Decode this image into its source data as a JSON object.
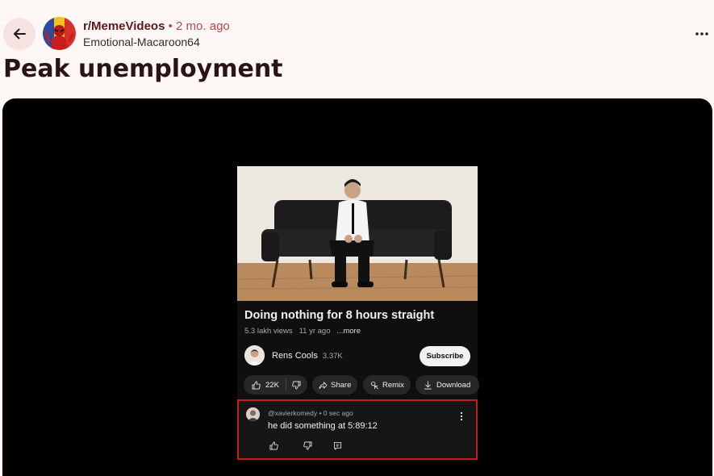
{
  "header": {
    "subreddit": "r/MemeVideos",
    "separator": "•",
    "age": "2 mo. ago",
    "author": "Emotional-Macaroon64",
    "more_icon": "more-horizontal-icon",
    "back_icon": "arrow-left-icon"
  },
  "post": {
    "title": "Peak unemployment"
  },
  "video": {
    "title": "Doing nothing for 8 hours straight",
    "views": "5.3 lakh views",
    "age": "11 yr ago",
    "more": "...more",
    "channel": {
      "name": "Rens Cools",
      "subscribers": "3.37K",
      "subscribe_label": "Subscribe"
    },
    "actions": {
      "likes": "22K",
      "share": "Share",
      "remix": "Remix",
      "download": "Download"
    },
    "comment": {
      "handle": "@xavierkomedy",
      "separator": "•",
      "age": "0 sec ago",
      "text": "he did something at 5:89:12"
    }
  },
  "colors": {
    "page_bg": "#fdf7f6",
    "subreddit": "#5a1a1a",
    "meta_accent": "#b54a47",
    "comment_highlight": "#c8191e"
  }
}
